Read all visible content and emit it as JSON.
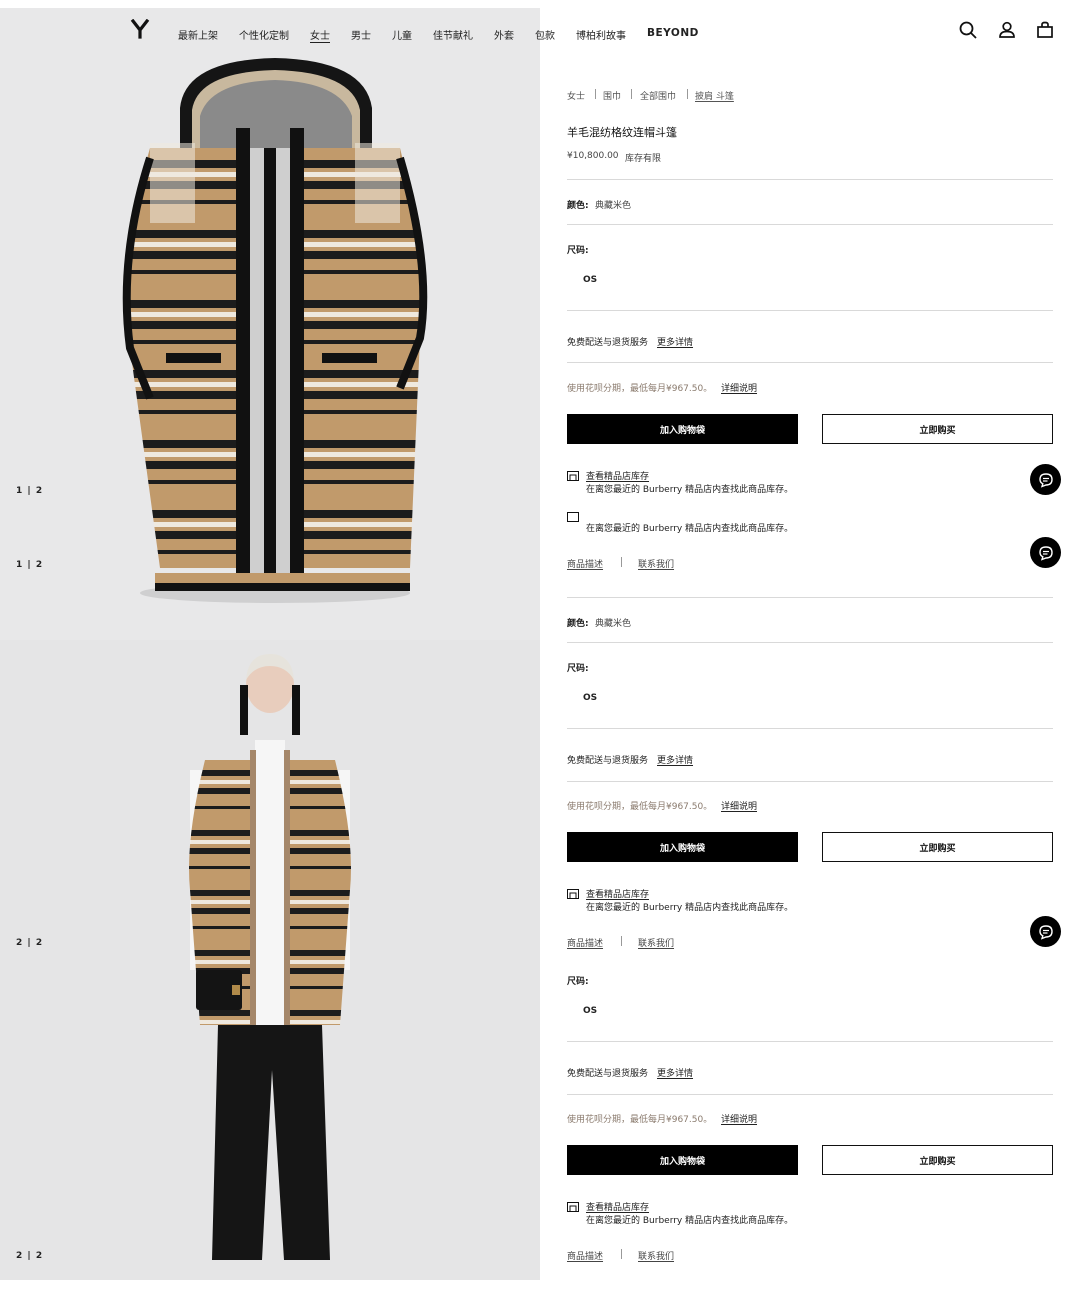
{
  "header": {
    "nav": [
      {
        "label": "最新上架"
      },
      {
        "label": "个性化定制"
      },
      {
        "label": "女士",
        "active": true
      },
      {
        "label": "男士"
      },
      {
        "label": "儿童"
      },
      {
        "label": "佳节献礼"
      },
      {
        "label": "外套"
      },
      {
        "label": "包款"
      },
      {
        "label": "博柏利故事"
      },
      {
        "label": "BEYOND"
      }
    ],
    "icons": [
      "logo-icon",
      "search-icon",
      "account-icon",
      "bag-icon"
    ]
  },
  "gallery": {
    "counters": [
      "1 | 2",
      "1 | 2",
      "2 | 2",
      "2 | 2"
    ]
  },
  "product": {
    "breadcrumb": [
      "女士",
      "围巾",
      "全部围巾",
      "披肩 斗篷"
    ],
    "title": "羊毛混纺格纹连帽斗篷",
    "price": "¥10,800.00",
    "stock": "库存有限",
    "color_label": "颜色:",
    "color_value": "典藏米色",
    "size_label": "尺码:",
    "size_value": "OS",
    "shipping": "免费配送与退货服务",
    "more_details": "更多详情",
    "installment": "使用花呗分期，最低每月¥967.50。",
    "installment_link": "详细说明",
    "add_to_bag": "加入购物袋",
    "buy_now": "立即购买",
    "store_link": "查看精品店库存",
    "store_desc": "在离您最近的 Burberry 精品店内查找此商品库存。",
    "description_link": "商品描述",
    "contact_link": "联系我们"
  },
  "colors": {
    "accent_black": "#000000",
    "muted_text": "#8a7a6d",
    "panel_bg": "#e8e8e9",
    "check_camel": "#c19a6b"
  }
}
